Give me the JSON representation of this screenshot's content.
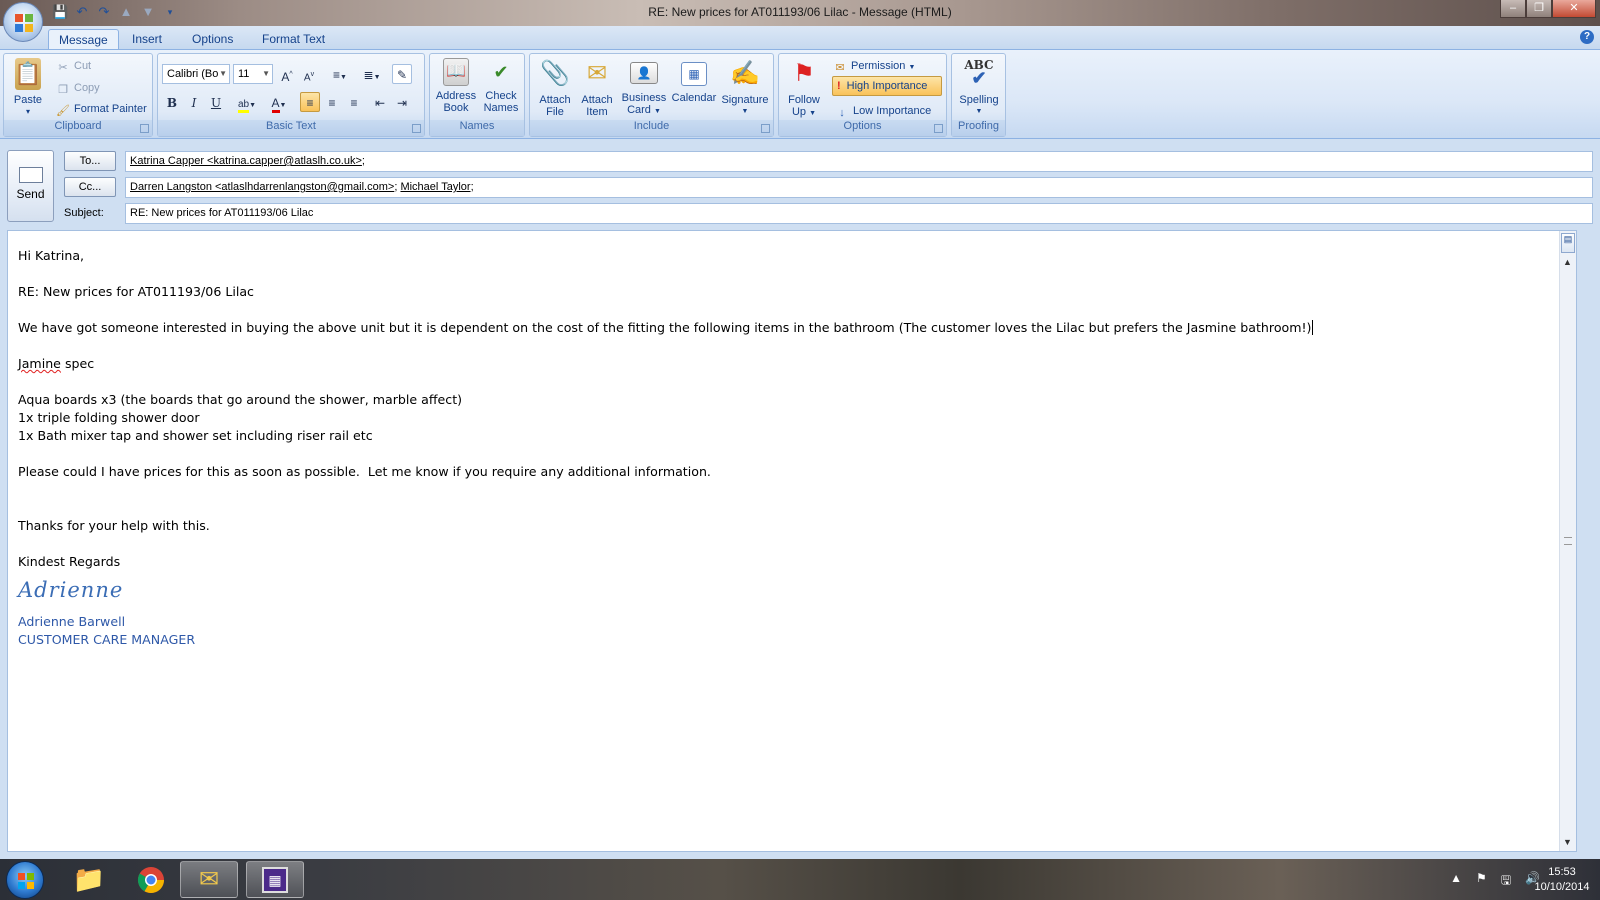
{
  "window": {
    "title": "RE: New prices for AT011193/06 Lilac - Message (HTML)"
  },
  "tabs": [
    {
      "label": "Message"
    },
    {
      "label": "Insert"
    },
    {
      "label": "Options"
    },
    {
      "label": "Format Text"
    }
  ],
  "ribbon": {
    "clipboard": {
      "label": "Clipboard",
      "paste": "Paste",
      "cut": "Cut",
      "copy": "Copy",
      "format_painter": "Format Painter"
    },
    "basic_text": {
      "label": "Basic Text",
      "font": "Calibri (Bo",
      "size": "11"
    },
    "names": {
      "label": "Names",
      "address_book_1": "Address",
      "address_book_2": "Book",
      "check_names_1": "Check",
      "check_names_2": "Names"
    },
    "include": {
      "label": "Include",
      "attach_file_1": "Attach",
      "attach_file_2": "File",
      "attach_item_1": "Attach",
      "attach_item_2": "Item",
      "business_card_1": "Business",
      "business_card_2": "Card",
      "calendar": "Calendar",
      "signature": "Signature"
    },
    "options": {
      "label": "Options",
      "follow_up_1": "Follow",
      "follow_up_2": "Up",
      "permission": "Permission",
      "high_importance": "High Importance",
      "low_importance": "Low Importance"
    },
    "proofing": {
      "label": "Proofing",
      "spelling": "Spelling"
    }
  },
  "compose": {
    "send": "Send",
    "to_button": "To...",
    "cc_button": "Cc...",
    "subject_label": "Subject:",
    "to_value": "Katrina Capper <katrina.capper@atlaslh.co.uk>",
    "to_sep": ";",
    "cc_value_1": "Darren Langston <atlaslhdarrenlangston@gmail.com>",
    "cc_sep": "; ",
    "cc_value_2": "Michael Taylor",
    "cc_sep_2": ";",
    "subject_value": "RE: New prices for AT011193/06 Lilac"
  },
  "body": {
    "greeting": "Hi Katrina,",
    "subject_line": "RE: New prices for AT011193/06 Lilac",
    "para1": "We have got someone interested in buying the above unit but it is dependent on the cost of the fitting the following items in the bathroom (The customer loves the Lilac but prefers the Jasmine bathroom!)",
    "spec_word": "Jamine",
    "spec_rest": " spec",
    "items": [
      "Aqua boards x3 (the boards that go around the shower, marble affect)",
      "1x triple folding shower door",
      "1x Bath mixer tap and shower set including riser rail etc"
    ],
    "para2": "Please could I have prices for this as soon as possible.  Let me know if you require any additional information.",
    "thanks": "Thanks for your help with this.",
    "closing": "Kindest Regards",
    "signature_script": "Adrienne",
    "sig_name": "Adrienne Barwell",
    "sig_role": "CUSTOMER CARE MANAGER"
  },
  "taskbar": {
    "time": "15:53",
    "date": "10/10/2014"
  },
  "colors": {
    "ribbon_text": "#15428b",
    "signature": "#2e58a8",
    "highlight_button": "#f9c25a"
  }
}
